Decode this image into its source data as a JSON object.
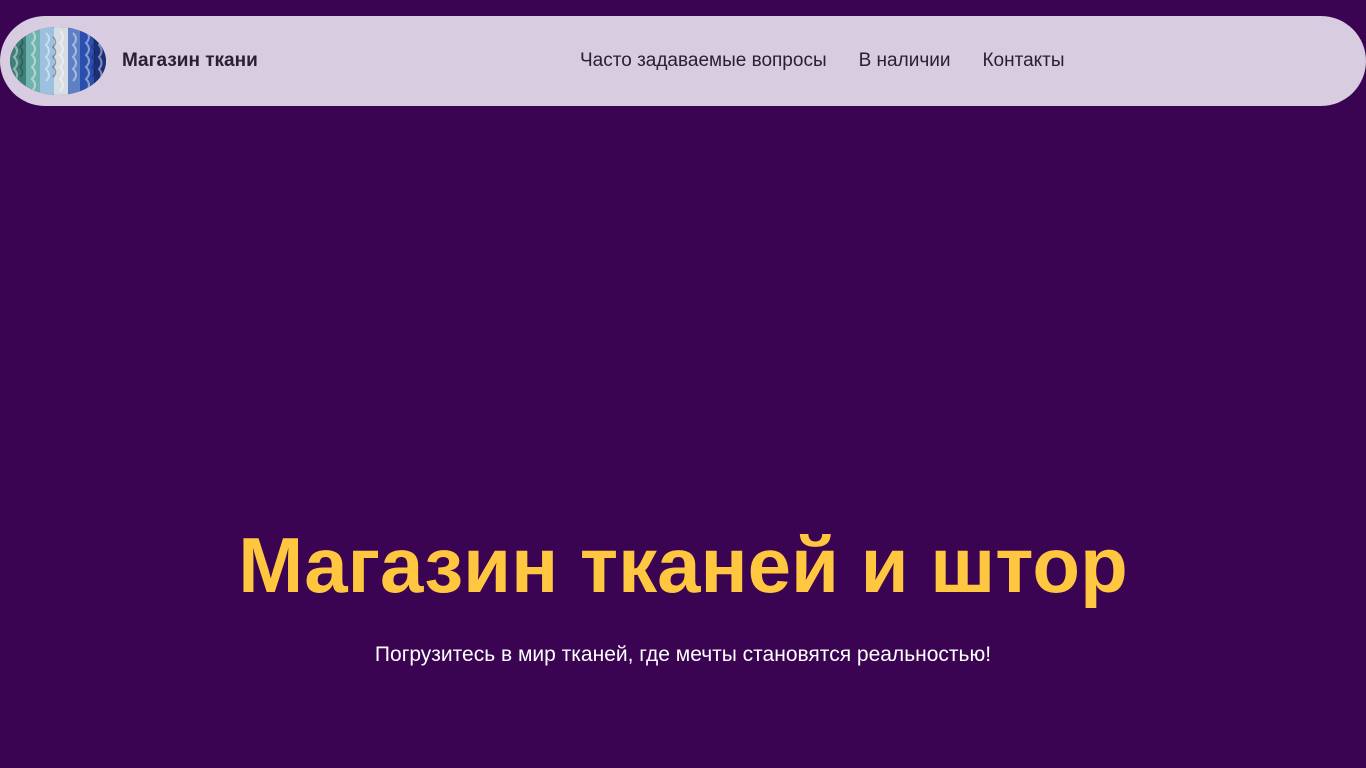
{
  "header": {
    "brand": "Магазин ткани",
    "logo_icon": "fabric-rolls-logo-icon",
    "nav": [
      {
        "label": "Часто задаваемые вопросы"
      },
      {
        "label": "В наличии"
      },
      {
        "label": "Контакты"
      }
    ]
  },
  "hero": {
    "title": "Магазин тканей и штор",
    "subtitle": "Погрузитесь в мир тканей, где мечты становятся реальностью!"
  },
  "colors": {
    "background": "#3a0453",
    "navbar": "#d8cde0",
    "accent": "#ffc63f",
    "text_light": "#ffffff",
    "text_dark": "#2a2030"
  }
}
